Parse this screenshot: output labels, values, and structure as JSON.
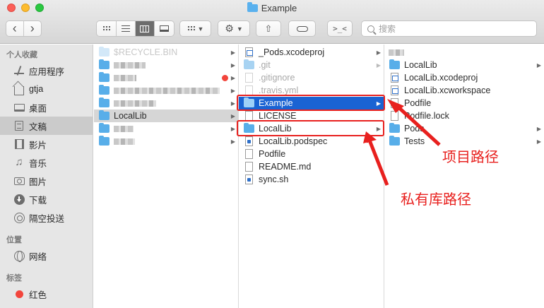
{
  "window": {
    "title": "Example"
  },
  "toolbar": {
    "back": "‹",
    "forward": "›",
    "search_placeholder": "搜索"
  },
  "sidebar": {
    "sections": [
      {
        "heading": "个人收藏",
        "items": [
          {
            "label": "应用程序",
            "icon": "apps-icon"
          },
          {
            "label": "gtja",
            "icon": "home-icon"
          },
          {
            "label": "桌面",
            "icon": "desktop-icon"
          },
          {
            "label": "文稿",
            "icon": "documents-icon",
            "selected": true
          },
          {
            "label": "影片",
            "icon": "movies-icon"
          },
          {
            "label": "音乐",
            "icon": "music-icon"
          },
          {
            "label": "图片",
            "icon": "pictures-icon"
          },
          {
            "label": "下载",
            "icon": "downloads-icon"
          },
          {
            "label": "隔空投送",
            "icon": "airdrop-icon"
          }
        ]
      },
      {
        "heading": "位置",
        "items": [
          {
            "label": "网络",
            "icon": "network-icon"
          }
        ]
      },
      {
        "heading": "标签",
        "items": [
          {
            "label": "红色",
            "icon": "red-tag-icon",
            "color": "#f2453c"
          }
        ]
      }
    ]
  },
  "column1": {
    "items": [
      {
        "label": "$RECYCLE.BIN"
      },
      {
        "label": "LocalLib"
      }
    ]
  },
  "column2": {
    "items": [
      {
        "label": "_Pods.xcodeproj"
      },
      {
        "label": ".git"
      },
      {
        "label": ".gitignore"
      },
      {
        "label": ".travis.yml"
      },
      {
        "label": "Example"
      },
      {
        "label": "LICENSE"
      },
      {
        "label": "LocalLib"
      },
      {
        "label": "LocalLib.podspec"
      },
      {
        "label": "Podfile"
      },
      {
        "label": "README.md"
      },
      {
        "label": "sync.sh"
      }
    ]
  },
  "column3": {
    "items": [
      {
        "label": "LocalLib"
      },
      {
        "label": "LocalLib.xcodeproj"
      },
      {
        "label": "LocalLib.xcworkspace"
      },
      {
        "label": "Podfile"
      },
      {
        "label": "Podfile.lock"
      },
      {
        "label": "Pods"
      },
      {
        "label": "Tests"
      }
    ]
  },
  "annotations": {
    "project_path": "项目路径",
    "private_lib_path": "私有库路径"
  },
  "colors": {
    "accent": "#1a63d3",
    "annotation": "#e8201e"
  }
}
